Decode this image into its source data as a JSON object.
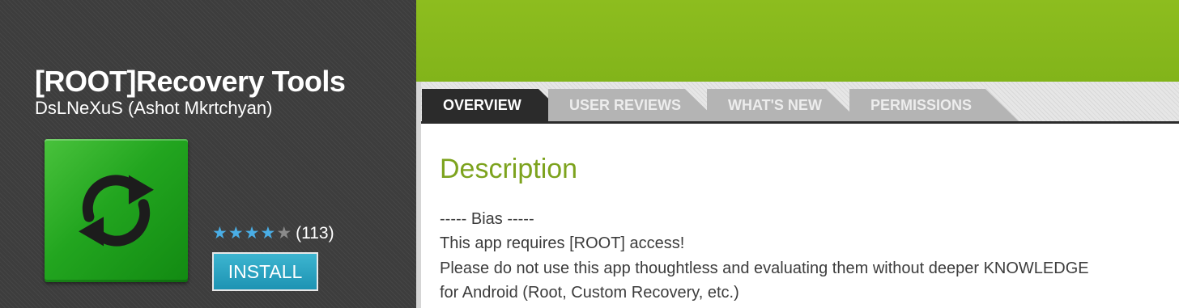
{
  "app": {
    "title": "[ROOT]Recovery Tools",
    "developer": "DsLNeXuS (Ashot Mkrtchyan)",
    "icon": "sync-arrows-icon",
    "rating": {
      "stars_filled": 4,
      "stars_total": 5,
      "count": "(113)"
    },
    "install_label": "INSTALL"
  },
  "tabs": [
    {
      "label": "OVERVIEW",
      "active": true
    },
    {
      "label": "USER REVIEWS",
      "active": false
    },
    {
      "label": "WHAT'S NEW",
      "active": false
    },
    {
      "label": "PERMISSIONS",
      "active": false
    }
  ],
  "description": {
    "heading": "Description",
    "lines": [
      "----- Bias -----",
      "This app requires [ROOT] access!",
      "Please do not use this app thoughtless and evaluating them without deeper KNOWLEDGE",
      "for Android (Root, Custom Recovery, etc.)"
    ]
  },
  "colors": {
    "accent_green": "#8dbd1f",
    "heading_green": "#7da31e",
    "install_blue": "#2aa3c4",
    "star_blue": "#4aaee6",
    "dark_panel": "#3d3d3d"
  }
}
